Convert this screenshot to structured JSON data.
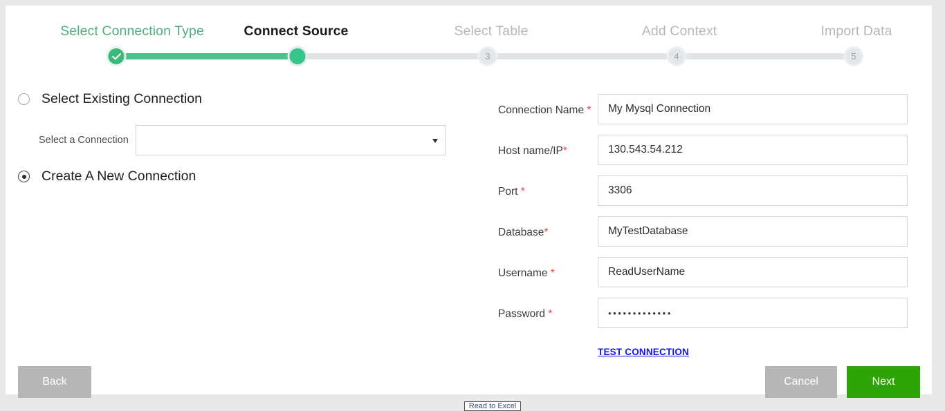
{
  "theme": {
    "page_bg": "#e7e8ea",
    "card_bg": "#ffffff",
    "accent_green": "#3cb878",
    "track_fill": "#4cc08a",
    "track_bg": "#e1e5e8",
    "required_red": "#f2413c",
    "link_blue": "#1313ef",
    "button_gray": "#b6b6b6",
    "button_green": "#2ea407"
  },
  "stepper": {
    "steps": [
      {
        "label": "Select Connection Type",
        "marker": "check",
        "state": "done"
      },
      {
        "label": "Connect Source",
        "marker": "2",
        "state": "current"
      },
      {
        "label": "Select Table",
        "marker": "3",
        "state": "pending"
      },
      {
        "label": "Add Context",
        "marker": "4",
        "state": "pending"
      },
      {
        "label": "Import Data",
        "marker": "5",
        "state": "pending"
      }
    ]
  },
  "left_pane": {
    "existing_radio_label": "Select Existing Connection",
    "existing_radio_checked": false,
    "select_label": "Select a Connection",
    "select_value": "",
    "select_placeholder": "",
    "new_radio_label": "Create A New Connection",
    "new_radio_checked": true
  },
  "form": {
    "fields": [
      {
        "label": "Connection Name ",
        "required": "*",
        "value": "My Mysql Connection",
        "placeholder": "",
        "type": "text"
      },
      {
        "label": "Host name/IP",
        "required": "*",
        "value": "130.543.54.212",
        "placeholder": "",
        "type": "text"
      },
      {
        "label": "Port ",
        "required": "*",
        "value": "3306",
        "placeholder": "",
        "type": "text"
      },
      {
        "label": "Database",
        "required": "*",
        "value": "MyTestDatabase",
        "placeholder": "",
        "type": "text"
      },
      {
        "label": "Username ",
        "required": "*",
        "value": "ReadUserName",
        "placeholder": "",
        "type": "text"
      },
      {
        "label": "Password ",
        "required": "*",
        "value": "•••••••••••••",
        "placeholder": "",
        "type": "password"
      }
    ],
    "test_connection_label": "TEST CONNECTION"
  },
  "footer": {
    "back_label": "Back",
    "cancel_label": "Cancel",
    "next_label": "Next"
  },
  "bottom_widget": {
    "text": "Read to Excel"
  }
}
